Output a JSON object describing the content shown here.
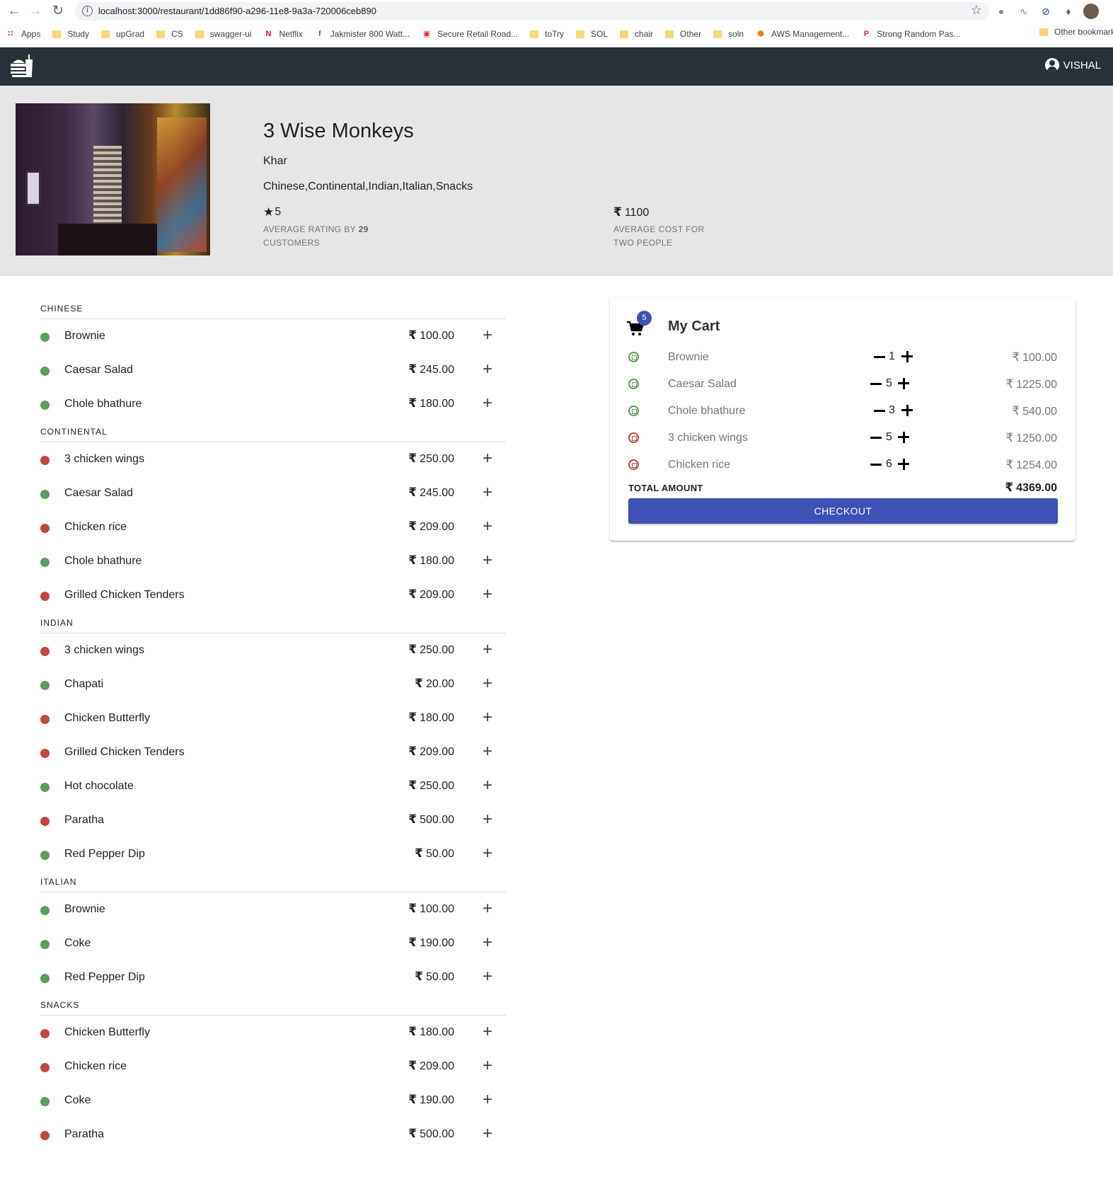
{
  "browser": {
    "url": "localhost:3000/restaurant/1dd86f90-a296-11e8-9a3a-720006ceb890",
    "bookmarks": [
      {
        "label": "Apps",
        "icon": "apps-grid-icon"
      },
      {
        "label": "Study",
        "icon": "folder-icon"
      },
      {
        "label": "upGrad",
        "icon": "folder-icon"
      },
      {
        "label": "CS",
        "icon": "folder-icon"
      },
      {
        "label": "swagger-ui",
        "icon": "folder-icon"
      },
      {
        "label": "Netflix",
        "icon": "netflix-icon"
      },
      {
        "label": "Jakmister 800 Watt...",
        "icon": "flipkart-icon"
      },
      {
        "label": "Secure Retail Road...",
        "icon": "site-icon"
      },
      {
        "label": "toTry",
        "icon": "folder-icon"
      },
      {
        "label": "SOL",
        "icon": "folder-icon"
      },
      {
        "label": "chair",
        "icon": "folder-icon"
      },
      {
        "label": "Other",
        "icon": "folder-icon"
      },
      {
        "label": "soln",
        "icon": "folder-icon"
      },
      {
        "label": "AWS Management...",
        "icon": "aws-icon"
      },
      {
        "label": "Strong Random Pas...",
        "icon": "password-icon"
      }
    ],
    "other_bookmarks": "Other bookmarks"
  },
  "header": {
    "user_name": "VISHAL"
  },
  "restaurant": {
    "name": "3 Wise Monkeys",
    "locality": "Khar",
    "categories": "Chinese,Continental,Indian,Italian,Snacks",
    "rating": "5",
    "rating_caption_prefix": "AVERAGE RATING BY",
    "rating_count": "29",
    "rating_caption_suffix": "CUSTOMERS",
    "currency_symbol": "₹",
    "avg_cost": "1100",
    "cost_caption": "AVERAGE COST FOR TWO PEOPLE"
  },
  "colors": {
    "veg": "#5a9e5a",
    "non_veg": "#c0463f",
    "appbar": "#263238",
    "primary": "#3f51b5"
  },
  "menu": [
    {
      "category": "CHINESE",
      "items": [
        {
          "name": "Brownie",
          "price": "100.00",
          "type": "veg"
        },
        {
          "name": "Caesar Salad",
          "price": "245.00",
          "type": "veg"
        },
        {
          "name": "Chole bhathure",
          "price": "180.00",
          "type": "veg"
        }
      ]
    },
    {
      "category": "CONTINENTAL",
      "items": [
        {
          "name": "3 chicken wings",
          "price": "250.00",
          "type": "non_veg"
        },
        {
          "name": "Caesar Salad",
          "price": "245.00",
          "type": "veg"
        },
        {
          "name": "Chicken rice",
          "price": "209.00",
          "type": "non_veg"
        },
        {
          "name": "Chole bhathure",
          "price": "180.00",
          "type": "veg"
        },
        {
          "name": "Grilled Chicken Tenders",
          "price": "209.00",
          "type": "non_veg"
        }
      ]
    },
    {
      "category": "INDIAN",
      "items": [
        {
          "name": "3 chicken wings",
          "price": "250.00",
          "type": "non_veg"
        },
        {
          "name": "Chapati",
          "price": "20.00",
          "type": "veg"
        },
        {
          "name": "Chicken Butterfly",
          "price": "180.00",
          "type": "non_veg"
        },
        {
          "name": "Grilled Chicken Tenders",
          "price": "209.00",
          "type": "non_veg"
        },
        {
          "name": "Hot chocolate",
          "price": "250.00",
          "type": "veg"
        },
        {
          "name": "Paratha",
          "price": "500.00",
          "type": "non_veg"
        },
        {
          "name": "Red Pepper Dip",
          "price": "50.00",
          "type": "veg"
        }
      ]
    },
    {
      "category": "ITALIAN",
      "items": [
        {
          "name": "Brownie",
          "price": "100.00",
          "type": "veg"
        },
        {
          "name": "Coke",
          "price": "190.00",
          "type": "veg"
        },
        {
          "name": "Red Pepper Dip",
          "price": "50.00",
          "type": "veg"
        }
      ]
    },
    {
      "category": "SNACKS",
      "items": [
        {
          "name": "Chicken Butterfly",
          "price": "180.00",
          "type": "non_veg"
        },
        {
          "name": "Chicken rice",
          "price": "209.00",
          "type": "non_veg"
        },
        {
          "name": "Coke",
          "price": "190.00",
          "type": "veg"
        },
        {
          "name": "Paratha",
          "price": "500.00",
          "type": "non_veg"
        }
      ]
    }
  ],
  "cart": {
    "title": "My Cart",
    "badge_count": "5",
    "items": [
      {
        "name": "Brownie",
        "qty": "1",
        "price": "100.00",
        "type": "veg"
      },
      {
        "name": "Caesar Salad",
        "qty": "5",
        "price": "1225.00",
        "type": "veg"
      },
      {
        "name": "Chole bhathure",
        "qty": "3",
        "price": "540.00",
        "type": "veg"
      },
      {
        "name": "3 chicken wings",
        "qty": "5",
        "price": "1250.00",
        "type": "non_veg"
      },
      {
        "name": "Chicken rice",
        "qty": "6",
        "price": "1254.00",
        "type": "non_veg"
      }
    ],
    "total_label": "TOTAL AMOUNT",
    "total_amount": "4369.00",
    "checkout_label": "CHECKOUT"
  }
}
